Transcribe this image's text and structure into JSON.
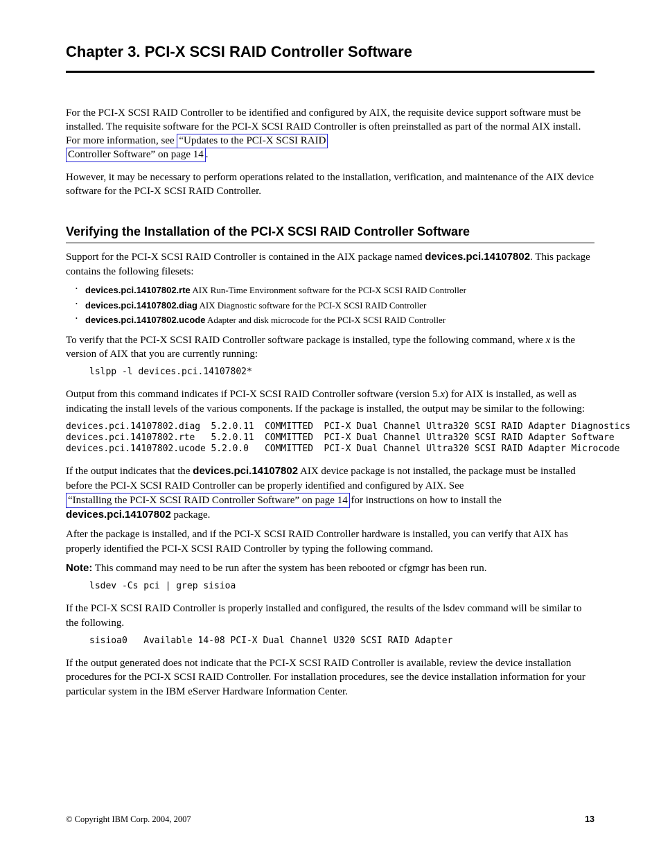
{
  "chapter": {
    "title": "Chapter 3. PCI-X SCSI RAID Controller Software",
    "preamble_p1_a": "For the PCI-X SCSI RAID Controller to be identified and configured by AIX, the requisite device support software must be installed. The requisite software for the PCI-X SCSI RAID Controller is often preinstalled as part of the normal AIX ",
    "preamble_p1_link": "install. For more information, see ",
    "cross_ref_link_text": "“Updates to the PCI-X SCSI RAID",
    "cross_ref_continued": "Controller Software” on page 14",
    "preamble_p1_end": ".",
    "preamble_p2": "However, it may be necessary to perform operations related to the installation, verification, and maintenance of the AIX device software for the PCI-X SCSI RAID Controller."
  },
  "section1": {
    "title": "Verifying the Installation of the PCI-X SCSI RAID Controller Software",
    "lead": "Support for the PCI-X SCSI RAID Controller is contained in the AIX package named ",
    "pkg": "devices.pci.14107802",
    "bullets_intro": ". This package contains the following filesets:",
    "bullets": [
      {
        "name": "devices.pci.14107802.rte",
        "desc": "AIX Run-Time Environment software for the PCI-X SCSI RAID Controller"
      },
      {
        "name": "devices.pci.14107802.diag",
        "desc": "AIX Diagnostic software for the PCI-X SCSI RAID Controller"
      },
      {
        "name": "devices.pci.14107802.ucode",
        "desc": "Adapter and disk microcode for the PCI-X SCSI RAID Controller"
      }
    ],
    "verify_lead_a": "To verify that the PCI-X SCSI RAID Controller software package is installed, type the following command, where ",
    "verify_lead_b": " is the version of AIX that you are currently running:",
    "verify_x": "x",
    "cmd1": "lslpp -l devices.pci.14107802*",
    "output_lead_a": "Output from this command indicates if PCI-X SCSI RAID Controller software (version 5.",
    "output_lead_b": ") for AIX is installed, as well as indicating the install levels of the various components. If the package is installed, the output may be similar to the following:",
    "output_block": "devices.pci.14107802.diag  5.2.0.11  COMMITTED  PCI-X Dual Channel Ultra320 SCSI RAID Adapter Diagnostics\ndevices.pci.14107802.rte   5.2.0.11  COMMITTED  PCI-X Dual Channel Ultra320 SCSI RAID Adapter Software\ndevices.pci.14107802.ucode 5.2.0.0   COMMITTED  PCI-X Dual Channel Ultra320 SCSI RAID Adapter Microcode",
    "post1a": "If the output indicates that the ",
    "post1b": " AIX device package is not installed, the package must be installed before the PCI-X SCSI RAID Controller can be properly identified and configured by AIX. See ",
    "post1link": "“Installing the PCI-X SCSI RAID Controller Software” on page 14",
    "post1c": " for instructions on how to install the ",
    "post1d": " package.",
    "post2": "After the package is installed, and if the PCI-X SCSI RAID Controller hardware is installed, you can verify that AIX has properly identified the PCI-X SCSI RAID Controller by typing the following command.",
    "note": "Note:",
    "note_text": " This command may need to be run after the system has been rebooted or cfgmgr has been run.",
    "cmd2": "lsdev -Cs pci | grep sisioa",
    "post3": "If the PCI-X SCSI RAID Controller is properly installed and configured, the results of the lsdev command will be similar to the following.",
    "output2": "sisioa0   Available 14-08 PCI-X Dual Channel U320 SCSI RAID Adapter",
    "post4": "If the output generated does not indicate that the PCI-X SCSI RAID Controller is available, review the device installation procedures for the PCI-X SCSI RAID Controller. For installation procedures, see the device installation information for your particular system in the IBM eServer Hardware Information Center."
  },
  "footer": {
    "copyright": "© Copyright IBM Corp. 2004, 2007",
    "page": "13"
  }
}
